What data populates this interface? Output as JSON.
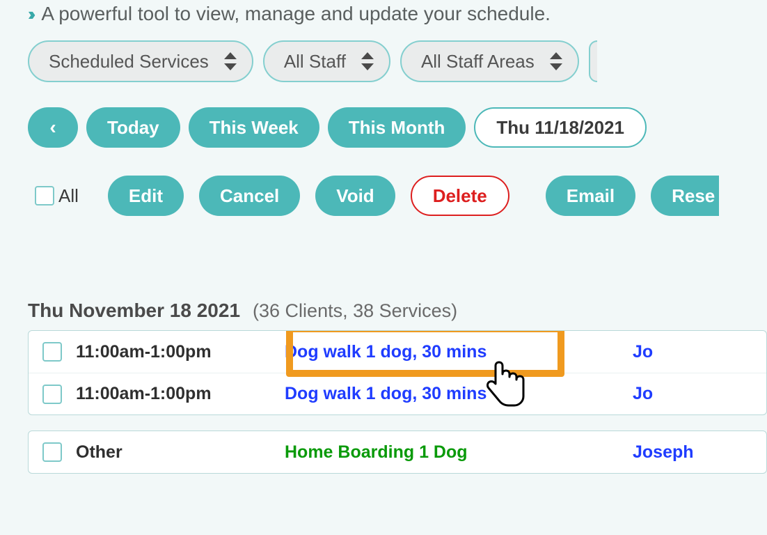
{
  "tagline": "A powerful tool to view, manage and update your schedule.",
  "filters": {
    "services": "Scheduled Services",
    "staff": "All Staff",
    "areas": "All Staff Areas"
  },
  "datenav": {
    "today": "Today",
    "this_week": "This Week",
    "this_month": "This Month",
    "date": "Thu 11/18/2021"
  },
  "actions": {
    "all": "All",
    "edit": "Edit",
    "cancel": "Cancel",
    "void": "Void",
    "delete": "Delete",
    "email": "Email",
    "resend": "Rese"
  },
  "schedule": {
    "heading_date": "Thu November 18 2021",
    "heading_count": "(36 Clients, 38 Services)",
    "groups": [
      {
        "rows": [
          {
            "time": "11:00am-1:00pm",
            "service": "Dog walk 1 dog, 30 mins",
            "service_color": "blue",
            "staff": "Jo"
          },
          {
            "time": "11:00am-1:00pm",
            "service": "Dog walk 1 dog, 30 mins",
            "service_color": "blue",
            "staff": "Jo"
          }
        ]
      },
      {
        "rows": [
          {
            "time": "Other",
            "service": "Home Boarding 1 Dog",
            "service_color": "green",
            "staff": "Joseph"
          }
        ]
      }
    ]
  }
}
